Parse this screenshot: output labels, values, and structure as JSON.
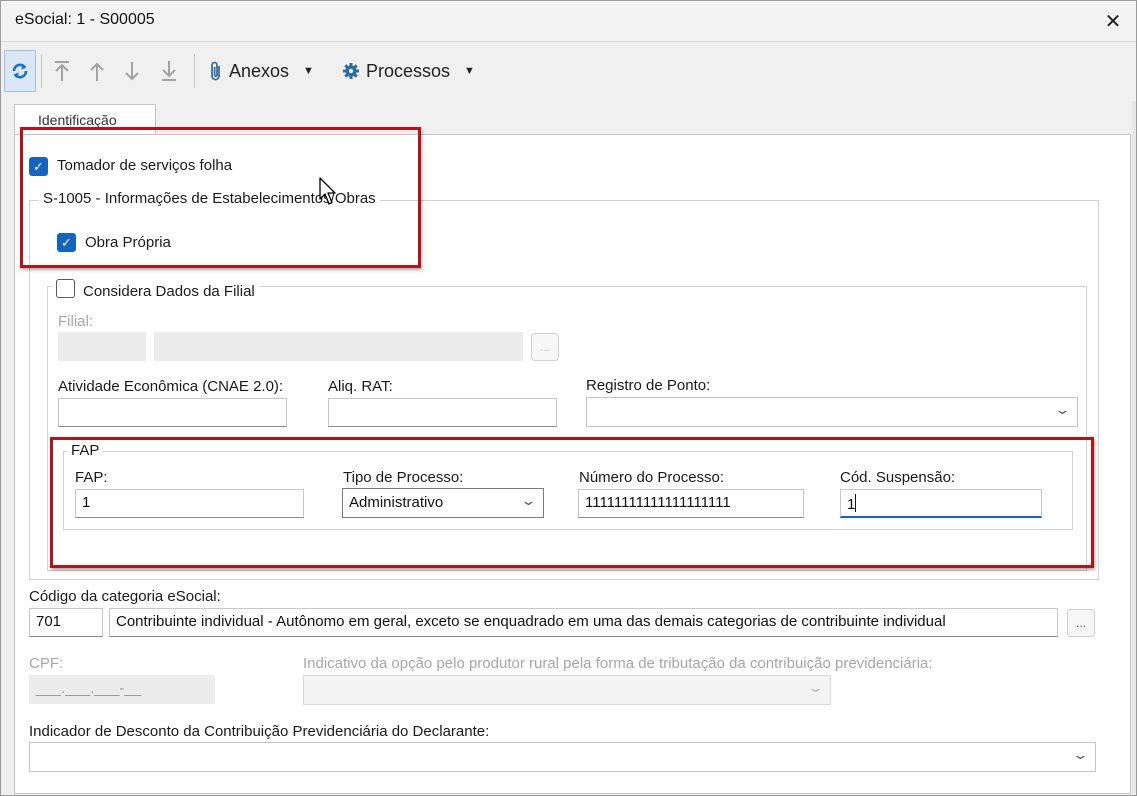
{
  "window": {
    "title": "eSocial: 1 - S00005",
    "close_glyph": "✕"
  },
  "toolbar": {
    "refresh_icon": "refresh-icon",
    "attachments_label": "Anexos",
    "processes_label": "Processos"
  },
  "tabs": [
    {
      "label": "Identificação"
    }
  ],
  "form": {
    "tomador_label": "Tomador de serviços folha",
    "tomador_checked": true,
    "s1005_legend": "S-1005 - Informações de Estabelecimentos/Obras",
    "obra_propria_label": "Obra Própria",
    "obra_propria_checked": true,
    "considera_filial_label": "Considera Dados da Filial",
    "considera_filial_checked": false,
    "filial_label": "Filial:",
    "filial_code": "",
    "filial_name": "",
    "cnae_label": "Atividade Econômica (CNAE 2.0):",
    "cnae_value": "",
    "aliq_rat_label": "Aliq. RAT:",
    "aliq_rat_value": "",
    "registro_ponto_label": "Registro de Ponto:",
    "registro_ponto_value": "",
    "fap_legend": "FAP",
    "fap_label": "FAP:",
    "fap_value": "1",
    "tipo_processo_label": "Tipo de Processo:",
    "tipo_processo_value": "Administrativo",
    "numero_processo_label": "Número do Processo:",
    "numero_processo_value": "11111111111111111111",
    "cod_suspensao_label": "Cód. Suspensão:",
    "cod_suspensao_value": "1",
    "categoria_label": "Código da categoria eSocial:",
    "categoria_code": "701",
    "categoria_desc": "Contribuinte individual - Autônomo em geral, exceto se enquadrado em uma das demais categorias de contribuinte individual",
    "cpf_label": "CPF:",
    "cpf_value": "___.___.___-__",
    "indicativo_label": "Indicativo da opção pelo produtor rural pela forma de tributação da contribuição previdenciária:",
    "indicativo_value": "",
    "desconto_label": "Indicador de Desconto da Contribuição Previdenciária do Declarante:",
    "desconto_value": ""
  },
  "colors": {
    "accent": "#1565c0",
    "highlight_frame": "#b3141b"
  }
}
